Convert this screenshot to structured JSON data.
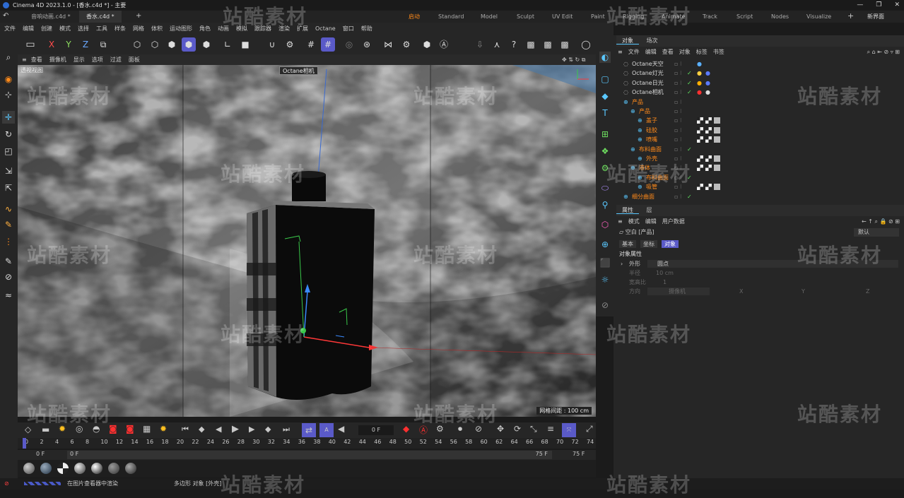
{
  "title": "Cinema 4D 2023.1.0 - [香水.c4d *] - 主要",
  "window_controls": [
    "—",
    "❐",
    "✕"
  ],
  "doc_tabs": [
    "音响动画.c4d *",
    "香水.c4d *"
  ],
  "layouts": [
    "启动",
    "Standard",
    "Model",
    "Sculpt",
    "UV Edit",
    "Paint",
    "Rigging",
    "Animate",
    "Track",
    "Script",
    "Nodes",
    "Visualize"
  ],
  "new_layout": "新界面",
  "menu": [
    "文件",
    "编辑",
    "创建",
    "模式",
    "选择",
    "工具",
    "样条",
    "网格",
    "体积",
    "运动图形",
    "角色",
    "动画",
    "模拟",
    "跟踪器",
    "渲染",
    "扩展",
    "Octane",
    "窗口",
    "帮助"
  ],
  "axes": [
    "X",
    "Y",
    "Z"
  ],
  "viewport_menu": [
    "查看",
    "摄像机",
    "显示",
    "选项",
    "过滤",
    "面板"
  ],
  "viewport_label": "透视视图",
  "camera_label": "Octane相机",
  "grid_info": "网格间距 : 100 cm",
  "frame_field": "0 F",
  "ruler_ticks": [
    "0",
    "2",
    "4",
    "6",
    "8",
    "10",
    "12",
    "14",
    "16",
    "18",
    "20",
    "22",
    "24",
    "26",
    "28",
    "30",
    "32",
    "34",
    "36",
    "38",
    "40",
    "42",
    "44",
    "46",
    "48",
    "50",
    "52",
    "54",
    "56",
    "58",
    "60",
    "62",
    "64",
    "66",
    "68",
    "70",
    "72",
    "74"
  ],
  "frames": {
    "start": "0 F",
    "current": "0 F",
    "end": "75 F",
    "end2": "75 F"
  },
  "status": {
    "left": "在图片查看器中渲染",
    "mid": "多边形 对象 [外壳]"
  },
  "object_panel": {
    "tabs": [
      "对象",
      "场次"
    ],
    "menu": [
      "文件",
      "编辑",
      "查看",
      "对象",
      "标签",
      "书签"
    ],
    "rows": [
      {
        "name": "Octane天空",
        "indent": 0,
        "orange": false
      },
      {
        "name": "Octane灯光",
        "indent": 0,
        "orange": false
      },
      {
        "name": "Octane日光",
        "indent": 0,
        "orange": false
      },
      {
        "name": "Octane相机",
        "indent": 0,
        "orange": false
      },
      {
        "name": "产品",
        "indent": 0,
        "orange": true
      },
      {
        "name": "产品",
        "indent": 1,
        "orange": true
      },
      {
        "name": "盖子",
        "indent": 2,
        "orange": true
      },
      {
        "name": "硅胶",
        "indent": 2,
        "orange": true
      },
      {
        "name": "喷嘴",
        "indent": 2,
        "orange": true
      },
      {
        "name": "布料曲面",
        "indent": 1,
        "orange": true
      },
      {
        "name": "外壳",
        "indent": 2,
        "orange": true
      },
      {
        "name": "液体",
        "indent": 1,
        "orange": true
      },
      {
        "name": "布料曲面",
        "indent": 2,
        "orange": true
      },
      {
        "name": "吸管",
        "indent": 2,
        "orange": true
      },
      {
        "name": "细分曲面",
        "indent": 0,
        "orange": true
      }
    ]
  },
  "attr_panel": {
    "tabs": [
      "属性",
      "层"
    ],
    "menu": [
      "模式",
      "编辑",
      "用户数据"
    ],
    "object": "空白 [产品]",
    "preset": "默认",
    "subtabs": [
      "基本",
      "坐标",
      "对象"
    ],
    "section": "对象属性",
    "fields": [
      {
        "label": "外形",
        "value": "圆点"
      },
      {
        "label": "半径",
        "value": "10 cm"
      },
      {
        "label": "宽高比",
        "value": "1"
      },
      {
        "label": "方向",
        "value": "摄像机"
      }
    ],
    "dir_cols": [
      "X",
      "Y",
      "Z"
    ]
  },
  "watermark": "站酷素材"
}
